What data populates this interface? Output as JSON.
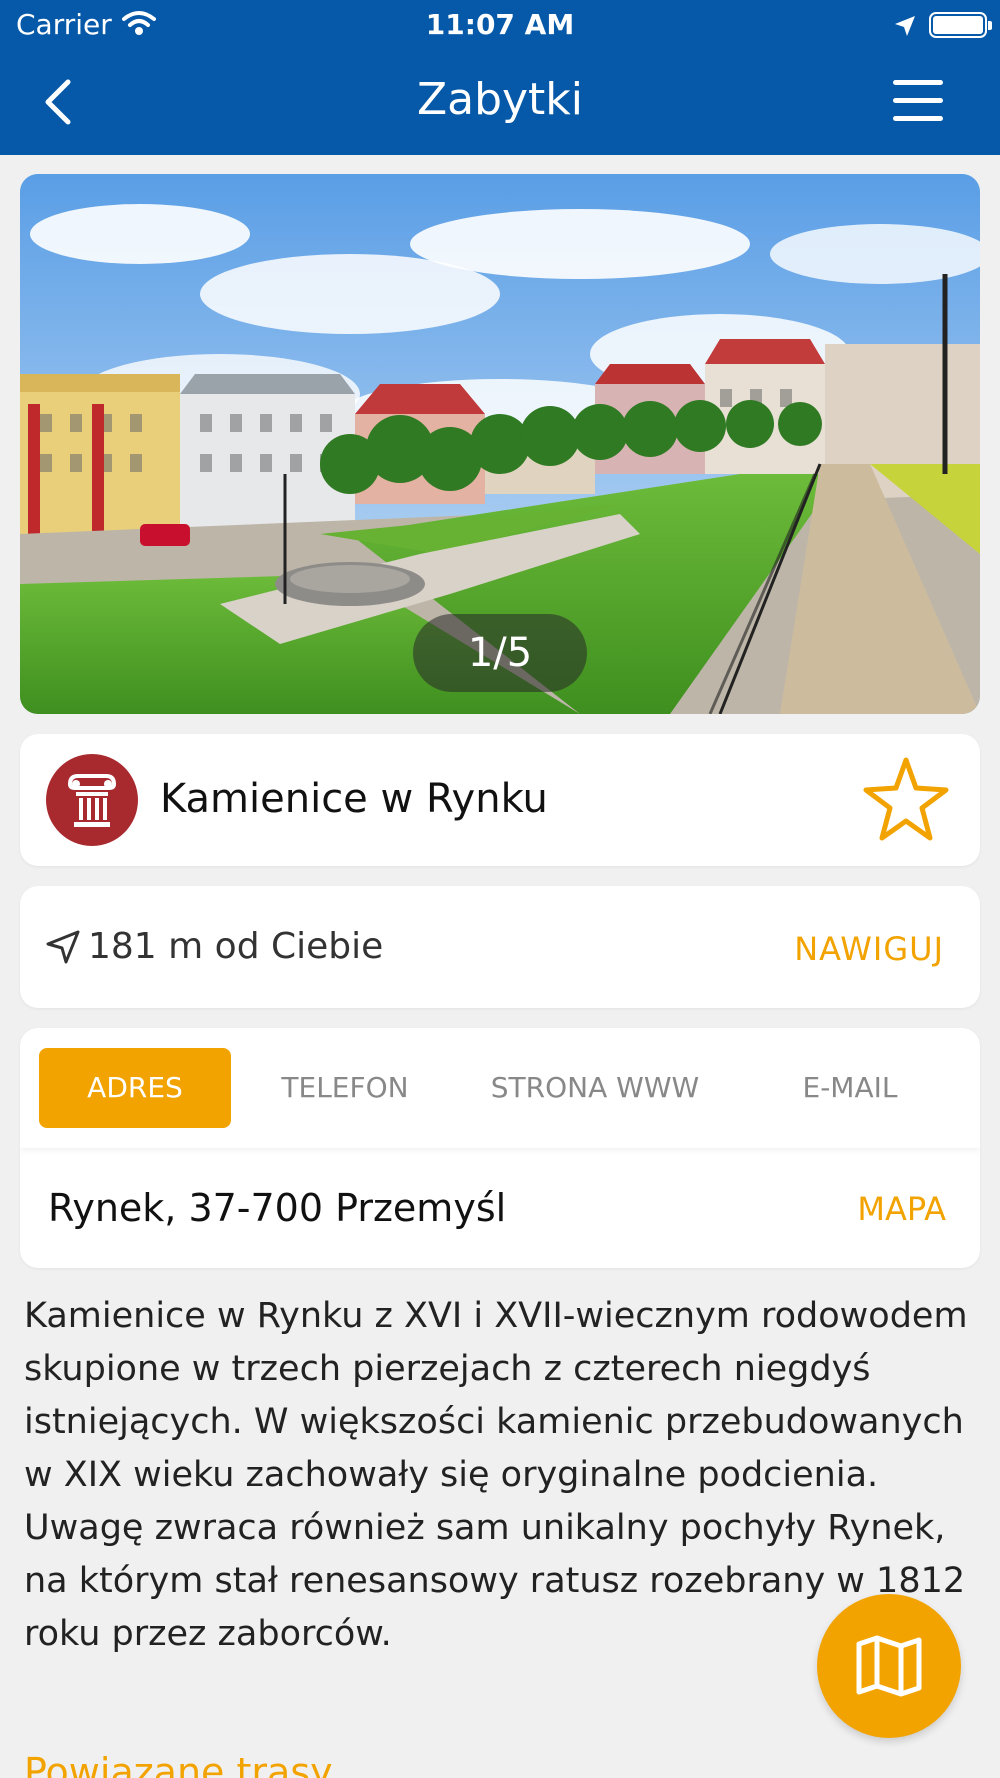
{
  "status_bar": {
    "carrier": "Carrier",
    "time": "11:07 AM",
    "battery_level": 1.0
  },
  "header": {
    "title": "Zabytki",
    "back_icon": "chevron-left-icon",
    "menu_icon": "hamburger-menu-icon"
  },
  "gallery": {
    "counter": "1/5"
  },
  "poi": {
    "name": "Kamienice w Rynku",
    "category_icon": "column-monument-icon",
    "category_color": "#a82a2f",
    "favorite_icon": "star-outline-icon"
  },
  "distance": {
    "text": "181 m od Ciebie",
    "navigate_label": "NAWIGUJ"
  },
  "contact": {
    "tabs": [
      "ADRES",
      "TELEFON",
      "STRONA WWW",
      "E-MAIL"
    ],
    "active_tab": "ADRES",
    "address": "Rynek, 37-700 Przemyśl",
    "map_label": "MAPA"
  },
  "description": "Kamienice w Rynku z XVI i XVII-wiecznym rodowodem skupione w trzech pierzejach z czterech niegdyś istniejących. W większości kamienic przebudowanych w XIX wieku zachowały się oryginalne podcienia. Uwagę zwraca również sam unikalny pochyły Rynek, na którym stał renesansowy ratusz rozebrany w 1812 roku przez zaborców.",
  "related_routes_heading": "Powiązane trasy",
  "colors": {
    "primary": "#0659a8",
    "accent": "#f2a300",
    "background": "#f0f0f0"
  },
  "fab_icon": "folded-map-icon"
}
